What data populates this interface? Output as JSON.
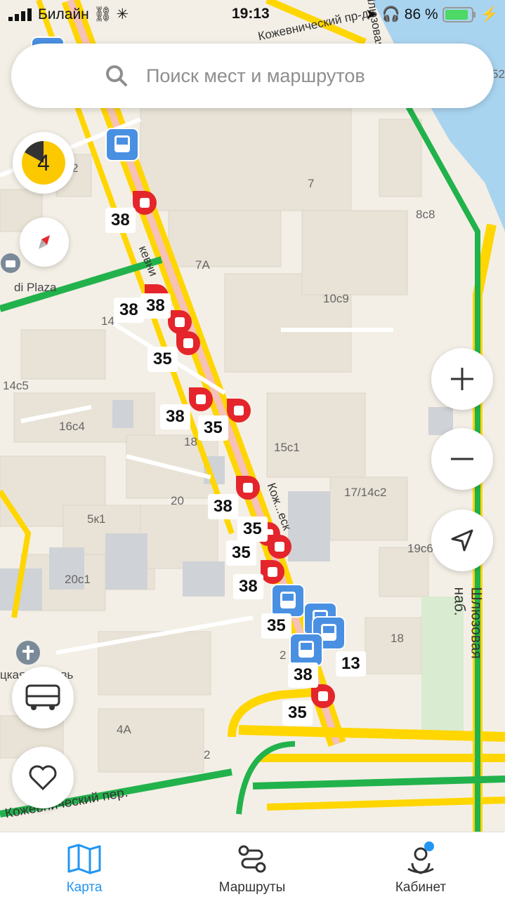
{
  "status_bar": {
    "carrier": "Билайн",
    "time": "19:13",
    "battery": "86 %"
  },
  "search": {
    "placeholder": "Поиск мест и маршрутов"
  },
  "traffic_score": "4",
  "stop_labels": [
    "38",
    "38",
    "38",
    "35",
    "38",
    "35",
    "38",
    "35",
    "35",
    "38",
    "35",
    "38",
    "35",
    "13"
  ],
  "map_labels": {
    "street_kozhev": "кевни",
    "street_kozh2": "Кож...еск",
    "street_per": "Кожевнический пер.",
    "street_nab": "Шлюзовая наб.",
    "street_top": "Кожевнический пр-д",
    "street_sl": "Шлюзовая",
    "plaza": "di Plaza",
    "church": "цкая церковь",
    "h7": "7",
    "h7a": "7А",
    "h8c8": "8с8",
    "h10c9": "10с9",
    "h14c5": "14с5",
    "h16c4": "16с4",
    "h15c1": "15с1",
    "h17": "17/14с2",
    "h20": "20",
    "h5k1": "5к1",
    "h20c1": "20с1",
    "h19c": "19с6",
    "h18": "18",
    "h4a": "4А",
    "h2": "2",
    "h8c2": "8с2",
    "h14": "14",
    "h18b": "18",
    "h52": "52",
    "h2b": "2"
  },
  "tabs": {
    "map": "Карта",
    "routes": "Маршруты",
    "cabinet": "Кабинет"
  },
  "colors": {
    "accent": "#2196f3",
    "traffic_yellow": "#ffd600",
    "traffic_green": "#22b24c",
    "pin_red": "#e4252b",
    "bus_blue": "#4a90e2",
    "water": "#a9d4f0"
  }
}
